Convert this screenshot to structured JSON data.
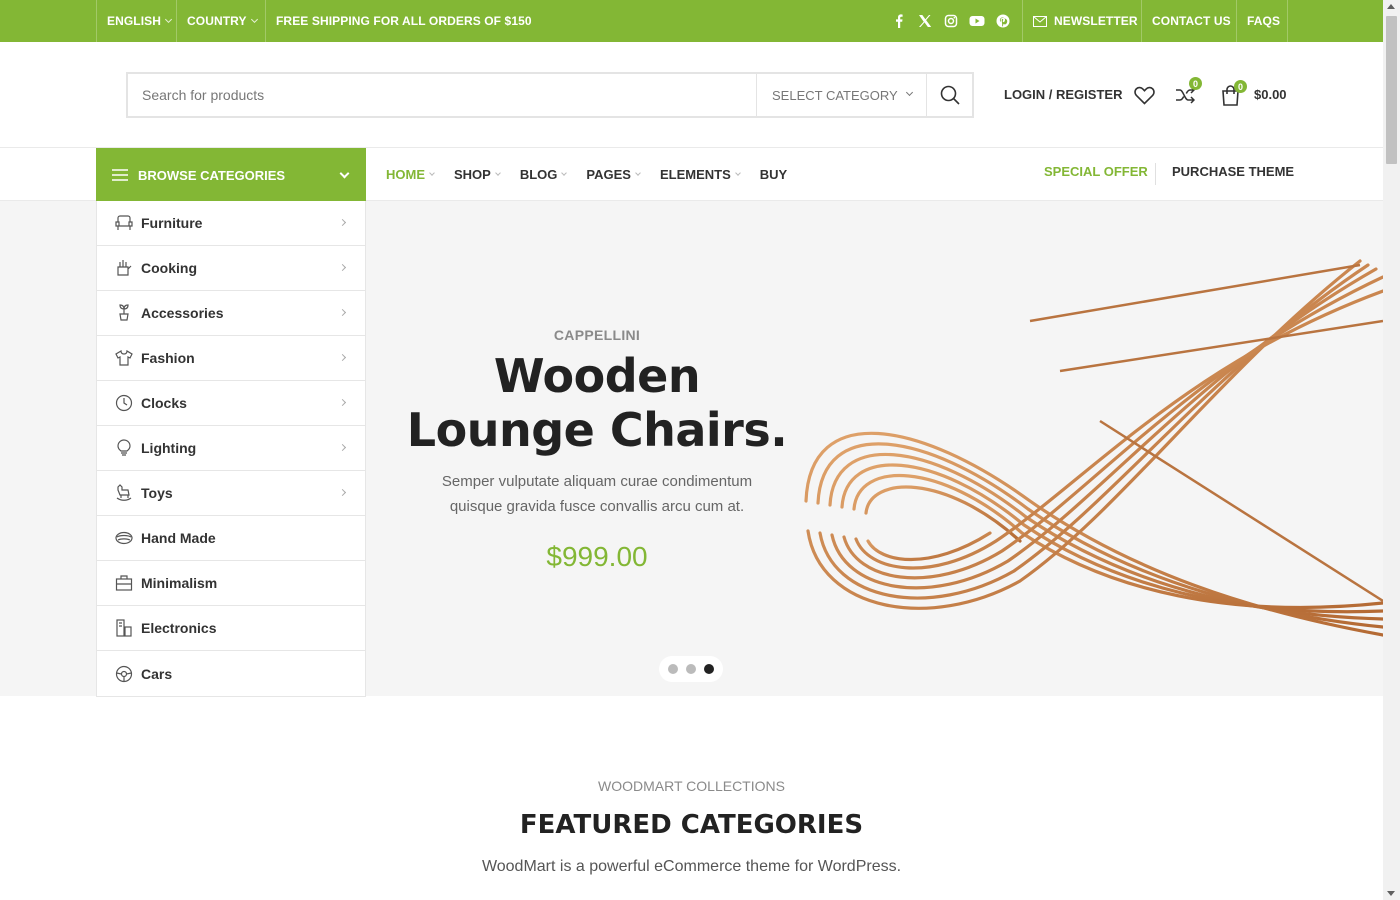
{
  "topbar": {
    "language": "ENGLISH",
    "country": "COUNTRY",
    "shipping": "FREE SHIPPING FOR ALL ORDERS OF $150",
    "social": [
      "facebook-icon",
      "x-icon",
      "instagram-icon",
      "youtube-icon",
      "pinterest-icon"
    ],
    "newsletter": "NEWSLETTER",
    "contact": "CONTACT US",
    "faqs": "FAQS"
  },
  "header": {
    "search_placeholder": "Search for products",
    "select_category": "SELECT CATEGORY",
    "login": "LOGIN / REGISTER",
    "compare_count": "0",
    "cart_count": "0",
    "cart_total": "$0.00"
  },
  "nav": {
    "browse": "BROWSE CATEGORIES",
    "items": [
      "HOME",
      "SHOP",
      "BLOG",
      "PAGES",
      "ELEMENTS",
      "BUY"
    ],
    "special_offer": "SPECIAL OFFER",
    "purchase_theme": "PURCHASE THEME"
  },
  "categories": [
    "Furniture",
    "Cooking",
    "Accessories",
    "Fashion",
    "Clocks",
    "Lighting",
    "Toys",
    "Hand Made",
    "Minimalism",
    "Electronics",
    "Cars"
  ],
  "hero": {
    "brand": "CAPPELLINI",
    "title_line1": "Wooden",
    "title_line2": "Lounge Chairs.",
    "desc_line1": "Semper vulputate aliquam curae condimentum",
    "desc_line2": "quisque gravida fusce convallis arcu cum at.",
    "price": "$999.00",
    "active_slide": 3
  },
  "featured": {
    "subtitle": "WOODMART COLLECTIONS",
    "title": "FEATURED CATEGORIES",
    "desc": "WoodMart is a powerful eCommerce theme for WordPress."
  },
  "colors": {
    "accent": "#83b735",
    "hero_bg": "#f5f5f5",
    "wood": "#c8824a"
  }
}
